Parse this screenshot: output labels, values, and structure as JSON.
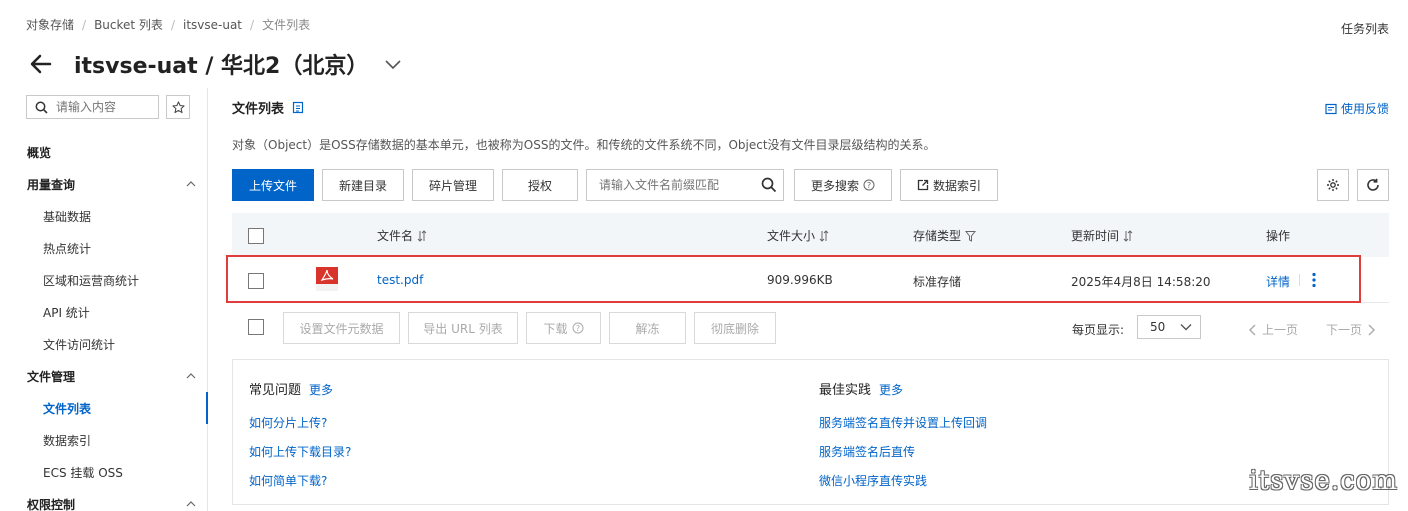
{
  "breadcrumb": [
    "对象存储",
    "Bucket 列表",
    "itsvse-uat",
    "文件列表"
  ],
  "top_right": {
    "task_list": "任务列表"
  },
  "page_title": "itsvse-uat / 华北2（北京）",
  "sidebar": {
    "search_placeholder": "请输入内容",
    "items": [
      {
        "label": "概览",
        "type": "group"
      },
      {
        "label": "用量查询",
        "type": "group",
        "expanded": true
      },
      {
        "label": "基础数据",
        "type": "child"
      },
      {
        "label": "热点统计",
        "type": "child"
      },
      {
        "label": "区域和运营商统计",
        "type": "child"
      },
      {
        "label": "API 统计",
        "type": "child"
      },
      {
        "label": "文件访问统计",
        "type": "child"
      },
      {
        "label": "文件管理",
        "type": "group",
        "expanded": true
      },
      {
        "label": "文件列表",
        "type": "child",
        "active": true
      },
      {
        "label": "数据索引",
        "type": "child"
      },
      {
        "label": "ECS 挂载 OSS",
        "type": "child"
      },
      {
        "label": "权限控制",
        "type": "group",
        "expanded": true
      }
    ]
  },
  "main": {
    "section_title": "文件列表",
    "feedback": "使用反馈",
    "description": "对象（Object）是OSS存储数据的基本单元，也被称为OSS的文件。和传统的文件系统不同，Object没有文件目录层级结构的关系。",
    "toolbar": {
      "upload": "上传文件",
      "new_dir": "新建目录",
      "fragments": "碎片管理",
      "authorize": "授权",
      "search_placeholder": "请输入文件名前缀匹配",
      "more_search": "更多搜索",
      "data_index": "数据索引"
    },
    "table": {
      "headers": {
        "name": "文件名",
        "size": "文件大小",
        "storage": "存储类型",
        "updated": "更新时间",
        "actions": "操作"
      },
      "rows": [
        {
          "name": "test.pdf",
          "size": "909.996KB",
          "storage": "标准存储",
          "updated": "2025年4月8日 14:58:20",
          "action": "详情",
          "icon": "pdf-file-icon"
        }
      ]
    },
    "bulk_actions": {
      "set_meta": "设置文件元数据",
      "export_urls": "导出 URL 列表",
      "download": "下载",
      "thaw": "解冻",
      "delete_all": "彻底删除"
    },
    "pager": {
      "label": "每页显示:",
      "page_size": "50",
      "prev": "上一页",
      "next": "下一页"
    },
    "help": {
      "faq": {
        "title": "常见问题",
        "more": "更多",
        "links": [
          "如何分片上传?",
          "如何上传下载目录?",
          "如何简单下载?"
        ]
      },
      "best": {
        "title": "最佳实践",
        "more": "更多",
        "links": [
          "服务端签名直传并设置上传回调",
          "服务端签名后直传",
          "微信小程序直传实践"
        ]
      }
    }
  },
  "watermark": "itsvse.com",
  "colors": {
    "primary": "#0064c8",
    "highlight_border": "#e03c3c",
    "pdf_red": "#d9342b"
  }
}
